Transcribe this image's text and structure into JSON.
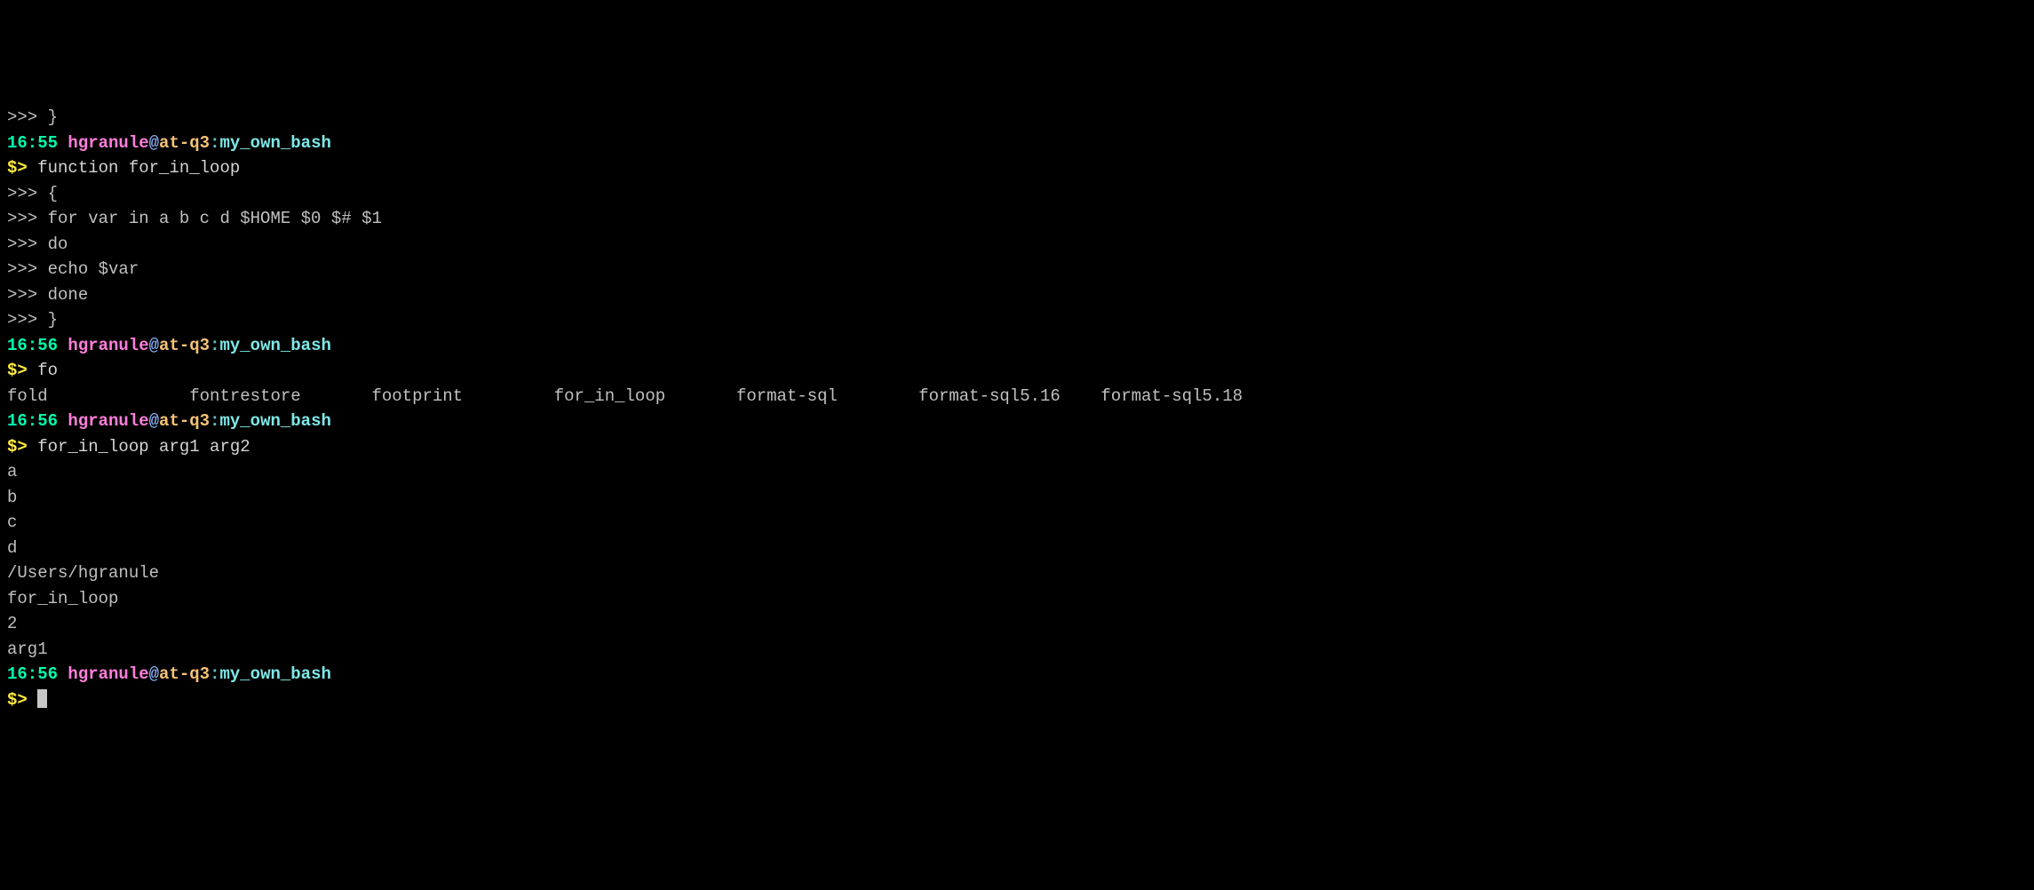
{
  "lines": [
    {
      "type": "cont",
      "text": ">>> }"
    },
    {
      "type": "prompt",
      "time": "16:55",
      "user": "hgranule",
      "at": "@",
      "host": "at-q3",
      "colon": ":",
      "path": "my_own_bash"
    },
    {
      "type": "cmd",
      "prompt": "$> ",
      "text": "function for_in_loop"
    },
    {
      "type": "cont",
      "text": ">>> {"
    },
    {
      "type": "cont",
      "text": ">>> for var in a b c d $HOME $0 $# $1"
    },
    {
      "type": "cont",
      "text": ">>> do"
    },
    {
      "type": "cont",
      "text": ">>> echo $var"
    },
    {
      "type": "cont",
      "text": ">>> done"
    },
    {
      "type": "cont",
      "text": ">>> }"
    },
    {
      "type": "prompt",
      "time": "16:56",
      "user": "hgranule",
      "at": "@",
      "host": "at-q3",
      "colon": ":",
      "path": "my_own_bash"
    },
    {
      "type": "cmd",
      "prompt": "$> ",
      "text": "fo"
    },
    {
      "type": "completions",
      "items": [
        "fold",
        "fontrestore",
        "footprint",
        "for_in_loop",
        "format-sql",
        "format-sql5.16",
        "format-sql5.18"
      ]
    },
    {
      "type": "prompt",
      "time": "16:56",
      "user": "hgranule",
      "at": "@",
      "host": "at-q3",
      "colon": ":",
      "path": "my_own_bash"
    },
    {
      "type": "cmd",
      "prompt": "$> ",
      "text": "for_in_loop arg1 arg2"
    },
    {
      "type": "output",
      "text": "a"
    },
    {
      "type": "output",
      "text": "b"
    },
    {
      "type": "output",
      "text": "c"
    },
    {
      "type": "output",
      "text": "d"
    },
    {
      "type": "output",
      "text": "/Users/hgranule"
    },
    {
      "type": "output",
      "text": "for_in_loop"
    },
    {
      "type": "output",
      "text": "2"
    },
    {
      "type": "output",
      "text": "arg1"
    },
    {
      "type": "prompt",
      "time": "16:56",
      "user": "hgranule",
      "at": "@",
      "host": "at-q3",
      "colon": ":",
      "path": "my_own_bash"
    },
    {
      "type": "cmd-cursor",
      "prompt": "$> "
    }
  ],
  "completion_col_width": 18
}
